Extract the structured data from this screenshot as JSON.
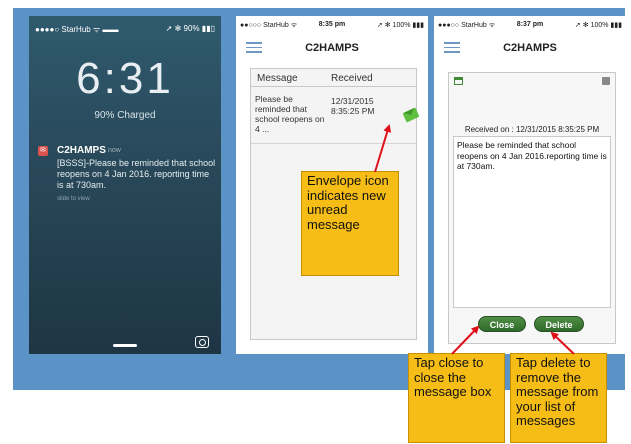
{
  "lock_screen": {
    "status_left": "●●●●○ StarHub ᯤ ▬▬",
    "status_right": "➚ ✻ 90% ▮▮▯",
    "time": "6:31",
    "charged": "90% Charged",
    "notification": {
      "app": "C2HAMPS",
      "time": "now",
      "message": "[BSSS]-Please be reminded that school reopens on 4 Jan 2016. reporting time is at 730am.",
      "hint": "slide to view"
    }
  },
  "list_screen": {
    "status_left": "●●○○○ StarHub ᯤ",
    "status_time": "8:35 pm",
    "status_right": "➚ ✻ 100% ▮▮▮",
    "title": "C2HAMPS",
    "columns": [
      "Message",
      "Received"
    ],
    "rows": [
      {
        "message": "Please be reminded that school reopens on 4 ...",
        "received": "12/31/2015 8:35:25 PM"
      }
    ]
  },
  "detail_screen": {
    "status_left": "●●●○○ StarHub ᯤ",
    "status_time": "8:37 pm",
    "status_right": "➚ ✻ 100% ▮▮▮",
    "title": "C2HAMPS",
    "received": "Received on : 12/31/2015 8:35:25 PM",
    "message": "Please be reminded that school reopens on 4 Jan 2016.reporting time is at 730am.",
    "close_label": "Close",
    "delete_label": "Delete"
  },
  "callouts": {
    "envelope": "Envelope icon indicates new unread message",
    "close": "Tap close to close the message box",
    "delete": "Tap delete to remove the message from your list of messages"
  },
  "colors": {
    "banner": "#5b93c6",
    "callout": "#f6bd16",
    "arrow": "#e0101a",
    "button": "#3f7f38"
  }
}
